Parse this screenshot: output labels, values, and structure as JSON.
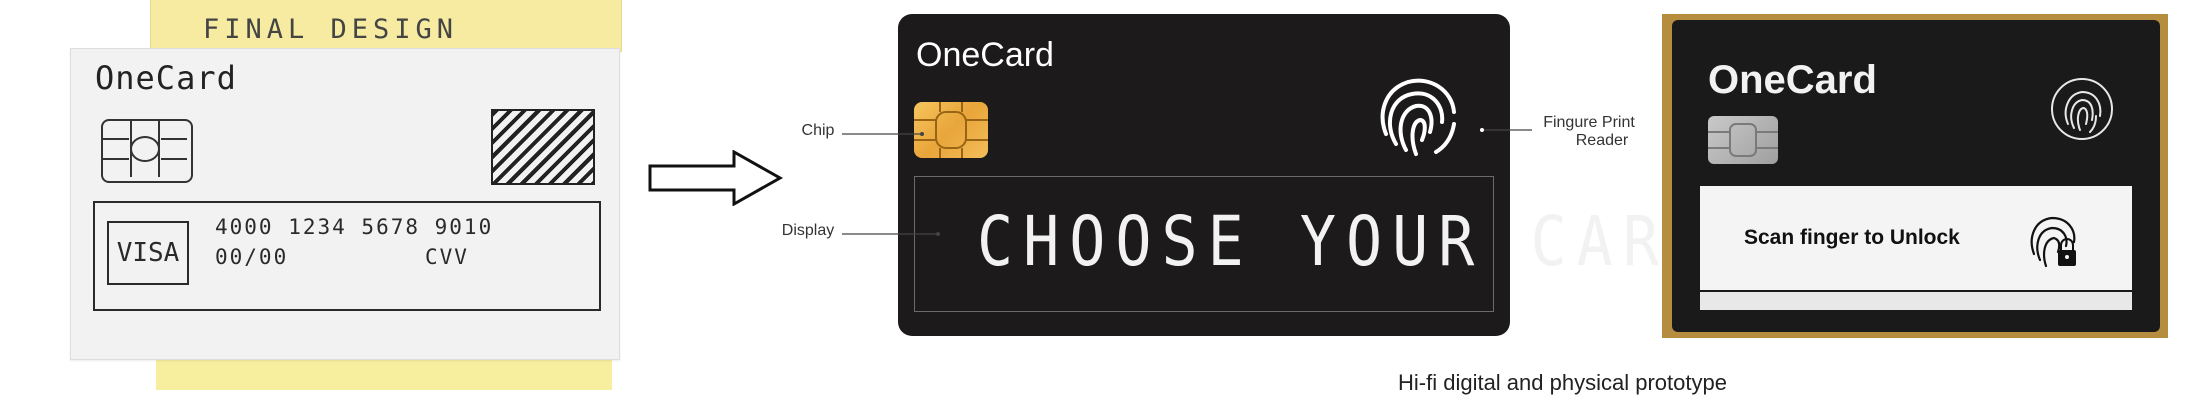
{
  "sketch": {
    "header": "FINAL DESIGN",
    "card_name": "OneCard",
    "brand": "VISA",
    "card_number": "4000 1234 5678 9010",
    "expiry": "00/00",
    "cvv": "CVV"
  },
  "digital_card": {
    "name": "OneCard",
    "display_text": "CHOOSE YOUR CARD",
    "labels": {
      "chip": "Chip",
      "display": "Display",
      "fingerprint_line1": "Fingure Print",
      "fingerprint_line2": "Reader"
    }
  },
  "caption": "Hi-fi digital and physical prototype",
  "physical_card": {
    "name": "OneCard",
    "screen_text": "Scan finger to Unlock"
  },
  "colors": {
    "card_background": "#1c1a1a",
    "chip_gold": "#e8a53a",
    "sticky_note": "#f6eba0"
  },
  "icons": [
    "fingerprint-icon",
    "lock-icon",
    "arrow-right-icon"
  ]
}
